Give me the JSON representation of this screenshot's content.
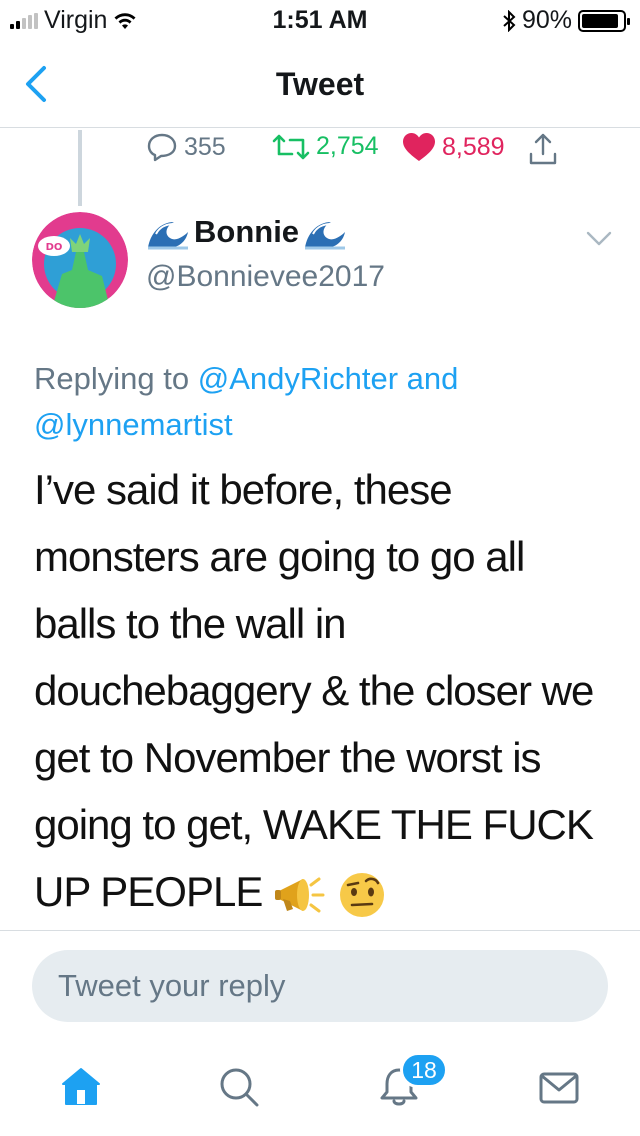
{
  "status_bar": {
    "carrier": "Virgin",
    "time": "1:51 AM",
    "battery": "90%",
    "battery_level": 0.9,
    "signal_bars": 2
  },
  "nav": {
    "title": "Tweet"
  },
  "previous_tweet_stats": {
    "replies": "355",
    "retweets": "2,754",
    "likes": "8,589",
    "retweet_color": "#17bf63",
    "like_color": "#e0245e"
  },
  "tweet": {
    "author_name": "Bonnie",
    "author_handle": "@Bonnievee2017",
    "name_emoji_icon": "water-wave-icon",
    "replying_prefix": "Replying to",
    "replying_handle_1": "@AndyRichter",
    "replying_and": "and",
    "replying_handle_2": "@lynnemartist",
    "text": "I’ve said it before, these monsters are going to go all balls to the wall in douchebaggery & the closer we get to November the worst is going to get, WAKE THE FUCK UP PEOPLE",
    "trailing_emoji": [
      "megaphone-icon",
      "face-with-raised-eyebrow-icon"
    ]
  },
  "reply_box": {
    "placeholder": "Tweet your reply"
  },
  "tab_bar": {
    "items": [
      "home-icon",
      "search-icon",
      "notifications-icon",
      "messages-icon"
    ],
    "notification_count": "18",
    "accent": "#1da1f2"
  }
}
